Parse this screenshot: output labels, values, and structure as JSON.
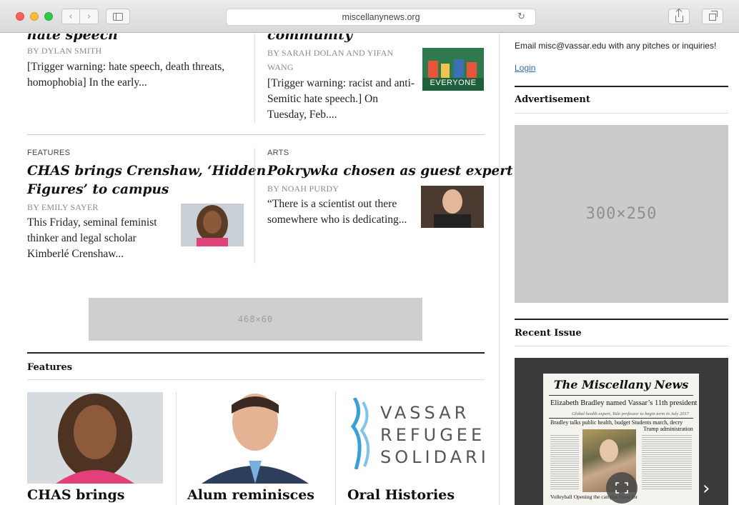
{
  "browser": {
    "url": "miscellanynews.org",
    "back_glyph": "‹",
    "forward_glyph": "›",
    "reload_glyph": "↻"
  },
  "top_stories": [
    {
      "title": "hate speech",
      "byline": "By DYLAN SMITH",
      "excerpt": "[Trigger warning: hate speech, death threats, homophobia] In the early..."
    },
    {
      "title": "community",
      "byline_line1": "By SARAH DOLAN AND YIFAN",
      "byline_line2": "WANG",
      "excerpt": "[Trigger warning: racist and anti-Semitic hate speech.] On Tuesday, Feb....",
      "image_caption": "EVERYONE"
    }
  ],
  "mid_stories": [
    {
      "category": "FEATURES",
      "title_line1": "CHAS brings Crenshaw, ‘Hidden",
      "title_line2": "Figures’ to campus",
      "byline": "By EMILY SAYER",
      "excerpt": "This Friday, seminal feminist thinker and legal scholar Kimberlé Crenshaw..."
    },
    {
      "category": "ARTS",
      "title": "Pokrywka chosen as guest expert",
      "byline": "By NOAH PURDY",
      "excerpt": "“There is a scientist out there somewhere who is dedicating..."
    }
  ],
  "banner_ad": {
    "label": "468×60"
  },
  "features": {
    "heading": "Features",
    "cards": [
      {
        "title": "CHAS brings"
      },
      {
        "title": "Alum reminisces"
      },
      {
        "title": "Oral Histories",
        "logo_lines": [
          "VASSAR",
          "REFUGEE",
          "SOLIDARI"
        ]
      }
    ]
  },
  "sidebar": {
    "contact_text": "Email misc@vassar.edu with any pitches or inquiries!",
    "login_label": "Login",
    "advertisement_heading": "Advertisement",
    "ad_label": "300×250",
    "recent_issue_heading": "Recent Issue",
    "newspaper": {
      "masthead": "The Miscellany News",
      "headline": "Elizabeth Bradley named Vassar’s 11th president",
      "subhead": "Global health expert, Yale professor to begin term in July 2017",
      "second_headline": "Bradley talks public health, budget  Students march, decry",
      "second_headline_b": "Trump administration",
      "footer": "Volleyball  Opening       the campus  Food for"
    },
    "next_glyph": "›"
  },
  "colors": {
    "link": "#2a6ebb",
    "ad_gray": "#cbcbcb",
    "issue_bg": "#3a3a3a"
  }
}
